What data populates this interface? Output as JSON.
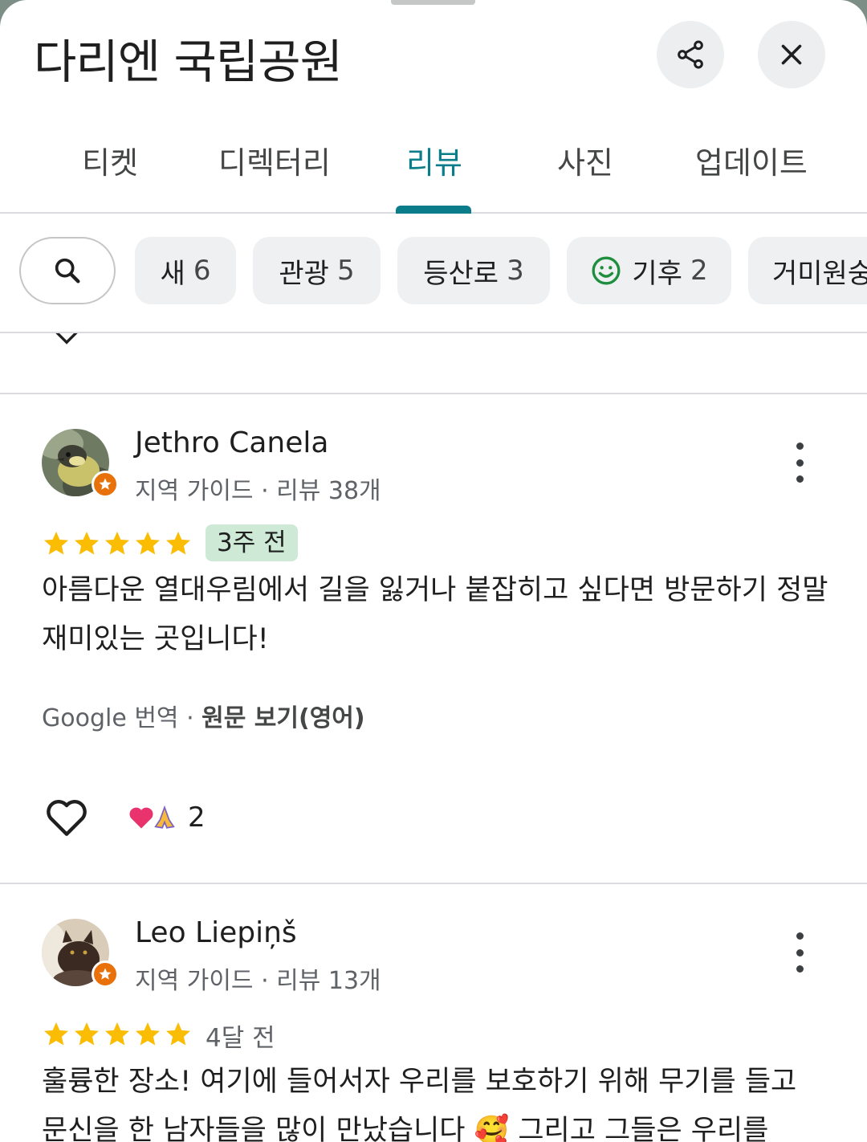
{
  "header": {
    "title": "다리엔 국립공원",
    "share_icon": "share-icon",
    "close_icon": "close-icon"
  },
  "tabs": [
    {
      "label": "티켓",
      "active": false
    },
    {
      "label": "디렉터리",
      "active": false
    },
    {
      "label": "리뷰",
      "active": true
    },
    {
      "label": "사진",
      "active": false
    },
    {
      "label": "업데이트",
      "active": false
    }
  ],
  "filters": {
    "search_icon": "search-icon",
    "chips": [
      {
        "label": "새",
        "count": "6"
      },
      {
        "label": "관광",
        "count": "5"
      },
      {
        "label": "등산로",
        "count": "3"
      },
      {
        "label": "기후",
        "count": "2",
        "icon": "smiley-icon"
      },
      {
        "label": "거미원숭이",
        "count": ""
      }
    ]
  },
  "reviews": [
    {
      "author": "Jethro Canela",
      "meta": "지역 가이드 · 리뷰 38개",
      "rating": 5,
      "date": "3주 전",
      "date_highlighted": true,
      "text": "아름다운 열대우림에서 길을 잃거나 붙잡히고 싶다면 방문하기 정말 재미있는 곳입니다!",
      "translation_prefix": "Google 번역 · ",
      "translation_link": "원문 보기(영어)",
      "reaction_count": "2"
    },
    {
      "author": "Leo Liepiņš",
      "meta": "지역 가이드 · 리뷰 13개",
      "rating": 5,
      "date": "4달 전",
      "date_highlighted": false,
      "text": "훌륭한 장소! 여기에 들어서자 우리를 보호하기 위해 무기를 들고 문신을 한 남자들을 많이 만났습니다 🥰 그리고 그들은 우리를"
    }
  ],
  "colors": {
    "accent": "#0b7d8a",
    "star": "#fbbc04",
    "date_chip_bg": "#ceead6",
    "guide_badge": "#e8710a"
  }
}
